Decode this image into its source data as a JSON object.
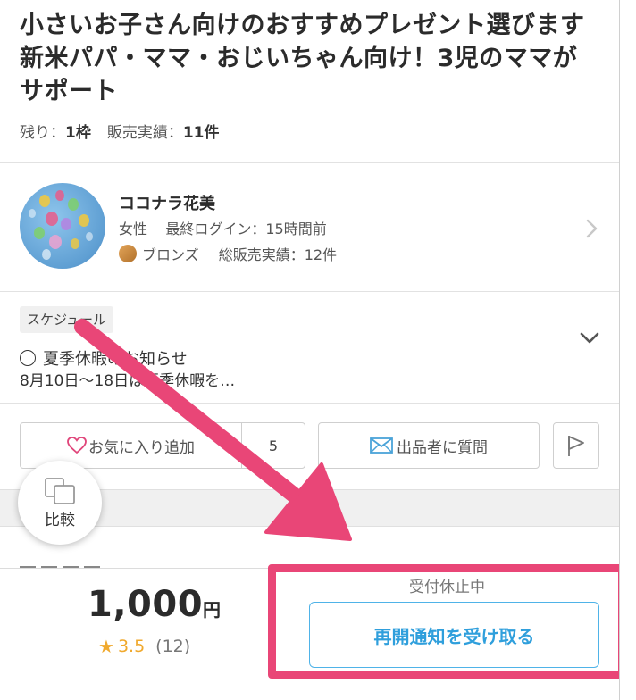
{
  "listing": {
    "title": "小さいお子さん向けのおすすめプレゼント選びます 新米パパ・ママ・おじいちゃん向け！3児のママがサポート",
    "remaining_label": "残り：",
    "remaining_value": "1枠",
    "sales_label": "販売実績：",
    "sales_value": "11件"
  },
  "seller": {
    "name": "ココナラ花美",
    "gender": "女性",
    "last_login": "最終ログイン：15時間前",
    "rank": "ブロンズ",
    "total_sales": "総販売実績：12件"
  },
  "schedule": {
    "tag": "スケジュール",
    "notice_title": "夏季休暇のお知らせ",
    "notice_body": "8月10日〜18日は夏季休暇を…"
  },
  "actions": {
    "favorite_label": "お気に入り追加",
    "favorite_count": "5",
    "ask_label": "出品者に質問"
  },
  "compare": {
    "label": "比較"
  },
  "purchase": {
    "price": "1,000",
    "price_unit": "円",
    "rating_score": "3.5",
    "rating_count": "(12)",
    "status": "受付休止中",
    "resume_button": "再開通知を受け取る"
  },
  "colors": {
    "accent_blue": "#2f9fdc",
    "highlight_pink": "#e94677",
    "star_orange": "#f0a92d"
  },
  "icons": [
    "chevron-right-icon",
    "chevron-down-icon",
    "heart-icon",
    "mail-icon",
    "flag-icon",
    "compare-icon",
    "star-icon"
  ]
}
